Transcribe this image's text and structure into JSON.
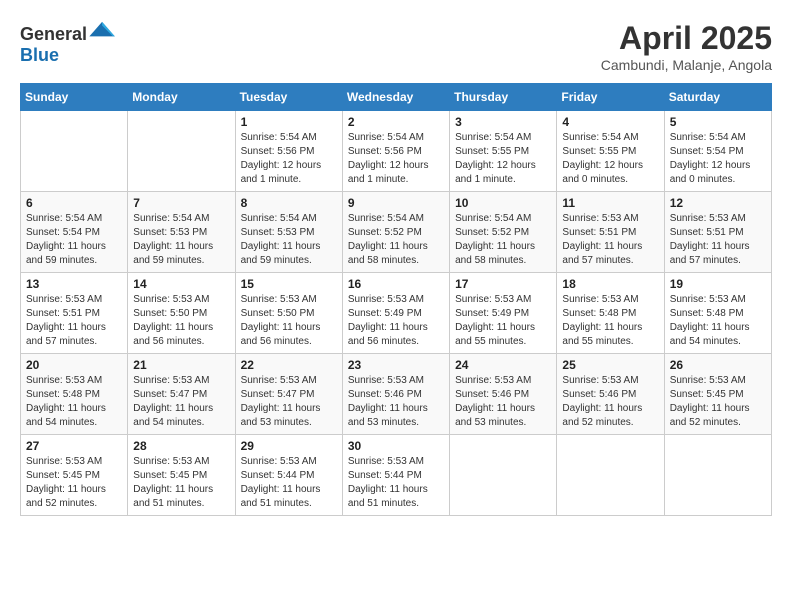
{
  "header": {
    "logo_general": "General",
    "logo_blue": "Blue",
    "month_title": "April 2025",
    "location": "Cambundi, Malanje, Angola"
  },
  "columns": [
    "Sunday",
    "Monday",
    "Tuesday",
    "Wednesday",
    "Thursday",
    "Friday",
    "Saturday"
  ],
  "weeks": [
    [
      {
        "day": "",
        "info": ""
      },
      {
        "day": "",
        "info": ""
      },
      {
        "day": "1",
        "info": "Sunrise: 5:54 AM\nSunset: 5:56 PM\nDaylight: 12 hours and 1 minute."
      },
      {
        "day": "2",
        "info": "Sunrise: 5:54 AM\nSunset: 5:56 PM\nDaylight: 12 hours and 1 minute."
      },
      {
        "day": "3",
        "info": "Sunrise: 5:54 AM\nSunset: 5:55 PM\nDaylight: 12 hours and 1 minute."
      },
      {
        "day": "4",
        "info": "Sunrise: 5:54 AM\nSunset: 5:55 PM\nDaylight: 12 hours and 0 minutes."
      },
      {
        "day": "5",
        "info": "Sunrise: 5:54 AM\nSunset: 5:54 PM\nDaylight: 12 hours and 0 minutes."
      }
    ],
    [
      {
        "day": "6",
        "info": "Sunrise: 5:54 AM\nSunset: 5:54 PM\nDaylight: 11 hours and 59 minutes."
      },
      {
        "day": "7",
        "info": "Sunrise: 5:54 AM\nSunset: 5:53 PM\nDaylight: 11 hours and 59 minutes."
      },
      {
        "day": "8",
        "info": "Sunrise: 5:54 AM\nSunset: 5:53 PM\nDaylight: 11 hours and 59 minutes."
      },
      {
        "day": "9",
        "info": "Sunrise: 5:54 AM\nSunset: 5:52 PM\nDaylight: 11 hours and 58 minutes."
      },
      {
        "day": "10",
        "info": "Sunrise: 5:54 AM\nSunset: 5:52 PM\nDaylight: 11 hours and 58 minutes."
      },
      {
        "day": "11",
        "info": "Sunrise: 5:53 AM\nSunset: 5:51 PM\nDaylight: 11 hours and 57 minutes."
      },
      {
        "day": "12",
        "info": "Sunrise: 5:53 AM\nSunset: 5:51 PM\nDaylight: 11 hours and 57 minutes."
      }
    ],
    [
      {
        "day": "13",
        "info": "Sunrise: 5:53 AM\nSunset: 5:51 PM\nDaylight: 11 hours and 57 minutes."
      },
      {
        "day": "14",
        "info": "Sunrise: 5:53 AM\nSunset: 5:50 PM\nDaylight: 11 hours and 56 minutes."
      },
      {
        "day": "15",
        "info": "Sunrise: 5:53 AM\nSunset: 5:50 PM\nDaylight: 11 hours and 56 minutes."
      },
      {
        "day": "16",
        "info": "Sunrise: 5:53 AM\nSunset: 5:49 PM\nDaylight: 11 hours and 56 minutes."
      },
      {
        "day": "17",
        "info": "Sunrise: 5:53 AM\nSunset: 5:49 PM\nDaylight: 11 hours and 55 minutes."
      },
      {
        "day": "18",
        "info": "Sunrise: 5:53 AM\nSunset: 5:48 PM\nDaylight: 11 hours and 55 minutes."
      },
      {
        "day": "19",
        "info": "Sunrise: 5:53 AM\nSunset: 5:48 PM\nDaylight: 11 hours and 54 minutes."
      }
    ],
    [
      {
        "day": "20",
        "info": "Sunrise: 5:53 AM\nSunset: 5:48 PM\nDaylight: 11 hours and 54 minutes."
      },
      {
        "day": "21",
        "info": "Sunrise: 5:53 AM\nSunset: 5:47 PM\nDaylight: 11 hours and 54 minutes."
      },
      {
        "day": "22",
        "info": "Sunrise: 5:53 AM\nSunset: 5:47 PM\nDaylight: 11 hours and 53 minutes."
      },
      {
        "day": "23",
        "info": "Sunrise: 5:53 AM\nSunset: 5:46 PM\nDaylight: 11 hours and 53 minutes."
      },
      {
        "day": "24",
        "info": "Sunrise: 5:53 AM\nSunset: 5:46 PM\nDaylight: 11 hours and 53 minutes."
      },
      {
        "day": "25",
        "info": "Sunrise: 5:53 AM\nSunset: 5:46 PM\nDaylight: 11 hours and 52 minutes."
      },
      {
        "day": "26",
        "info": "Sunrise: 5:53 AM\nSunset: 5:45 PM\nDaylight: 11 hours and 52 minutes."
      }
    ],
    [
      {
        "day": "27",
        "info": "Sunrise: 5:53 AM\nSunset: 5:45 PM\nDaylight: 11 hours and 52 minutes."
      },
      {
        "day": "28",
        "info": "Sunrise: 5:53 AM\nSunset: 5:45 PM\nDaylight: 11 hours and 51 minutes."
      },
      {
        "day": "29",
        "info": "Sunrise: 5:53 AM\nSunset: 5:44 PM\nDaylight: 11 hours and 51 minutes."
      },
      {
        "day": "30",
        "info": "Sunrise: 5:53 AM\nSunset: 5:44 PM\nDaylight: 11 hours and 51 minutes."
      },
      {
        "day": "",
        "info": ""
      },
      {
        "day": "",
        "info": ""
      },
      {
        "day": "",
        "info": ""
      }
    ]
  ]
}
